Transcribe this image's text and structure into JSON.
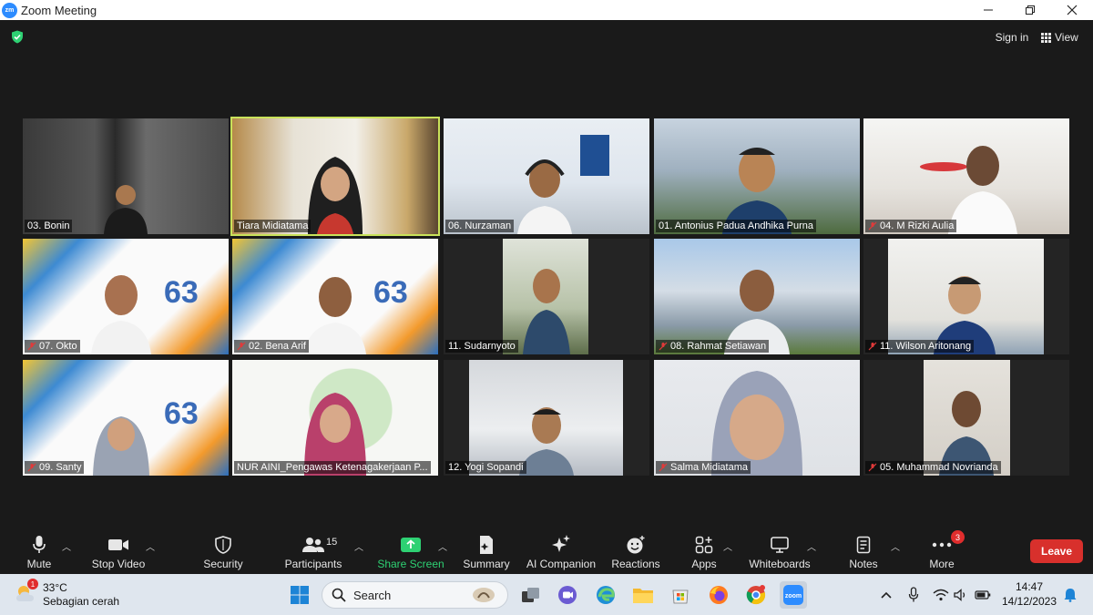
{
  "window": {
    "app_logo": "zm",
    "title": "Zoom Meeting",
    "controls": [
      "minimize-icon",
      "restore-icon",
      "close-icon"
    ]
  },
  "meeting_bar": {
    "security_icon": "shield-check-icon",
    "sign_in": "Sign in",
    "view": "View"
  },
  "colors": {
    "active_speaker_border": "#c9e25a",
    "share_screen_green": "#2ed173",
    "leave_red": "#d8302c",
    "background": "#1a1a1a"
  },
  "participants": [
    {
      "name": "03. Bonin",
      "muted": false,
      "active": false
    },
    {
      "name": "Tiara Midiatama",
      "muted": false,
      "active": true
    },
    {
      "name": "06. Nurzaman",
      "muted": false,
      "active": false
    },
    {
      "name": "01. Antonius Padua Andhika Purna",
      "muted": false,
      "active": false
    },
    {
      "name": "04. M Rizki Aulia",
      "muted": true,
      "active": false
    },
    {
      "name": "07. Okto",
      "muted": true,
      "active": false
    },
    {
      "name": "02. Bena Arif",
      "muted": true,
      "active": false
    },
    {
      "name": "11. Sudarnyoto",
      "muted": false,
      "active": false
    },
    {
      "name": "08. Rahmat Setiawan",
      "muted": true,
      "active": false
    },
    {
      "name": "11. Wilson Aritonang",
      "muted": true,
      "active": false
    },
    {
      "name": "09. Santy",
      "muted": true,
      "active": false
    },
    {
      "name": "NUR AINI_Pengawas Ketenagakerjaan P...",
      "muted": false,
      "active": false
    },
    {
      "name": "12. Yogi Sopandi",
      "muted": false,
      "active": false
    },
    {
      "name": "Salma Midiatama",
      "muted": true,
      "active": false
    },
    {
      "name": "05. Muhammad Novrianda",
      "muted": true,
      "active": false
    }
  ],
  "controls": {
    "mute": "Mute",
    "stop_video": "Stop Video",
    "security": "Security",
    "participants": "Participants",
    "participants_count": "15",
    "share_screen": "Share Screen",
    "summary": "Summary",
    "ai_companion": "AI Companion",
    "reactions": "Reactions",
    "apps": "Apps",
    "whiteboards": "Whiteboards",
    "notes": "Notes",
    "more": "More",
    "more_badge": "3",
    "leave": "Leave"
  },
  "taskbar": {
    "weather_temp": "33°C",
    "weather_desc": "Sebagian cerah",
    "weather_badge": "1",
    "search": "Search",
    "time": "14:47",
    "date": "14/12/2023",
    "apps": [
      "windows-start-icon",
      "task-view-icon",
      "chat-icon",
      "edge-icon",
      "file-explorer-icon",
      "store-icon",
      "firefox-icon",
      "chrome-icon",
      "zoom-icon"
    ],
    "tray": [
      "chevron-up-icon",
      "microphone-icon",
      "wifi-icon",
      "volume-icon",
      "battery-icon",
      "notification-bell-icon"
    ]
  }
}
